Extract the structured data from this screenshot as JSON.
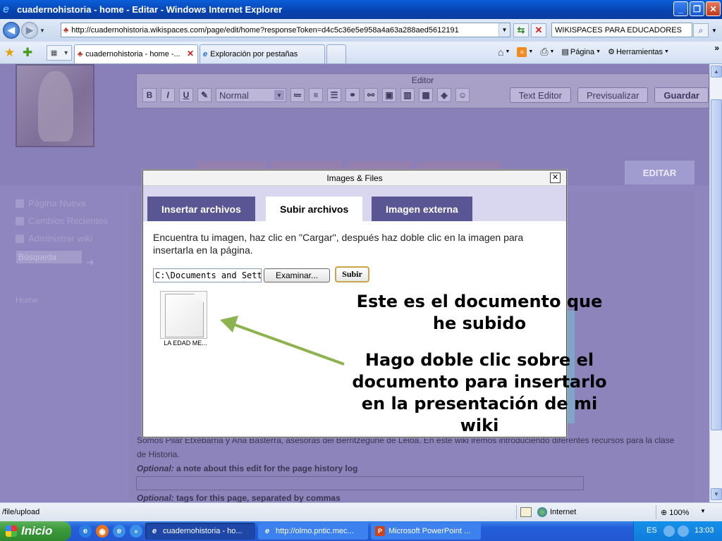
{
  "window": {
    "title": "cuadernohistoria - home - Editar - Windows Internet Explorer"
  },
  "address_bar": {
    "url": "http://cuadernohistoria.wikispaces.com/page/edit/home?responseToken=d4c5c36e5e958a4a63a288aed5612191",
    "search_value": "WIKISPACES PARA EDUCADORES"
  },
  "tabs": [
    {
      "label": "cuadernohistoria - home -..."
    },
    {
      "label": "Exploración por pestañas"
    }
  ],
  "command_bar": {
    "page": "Página",
    "tools": "Herramientas"
  },
  "editor": {
    "label": "Editor",
    "format": "Normal",
    "text_editor": "Text Editor",
    "preview": "Previsualizar",
    "save": "Guardar"
  },
  "wiki": {
    "editar_tab": "EDITAR",
    "sidebar": {
      "new_page": "Página Nueva",
      "recent_changes": "Cambios Recientes",
      "manage": "Administrar wiki",
      "search_placeholder": "Búsqueda",
      "home": "Home"
    },
    "intro": "Somos Pilar Etxebarria y Ana Basterra, asesoras del Berritzegune de Leioa. En este wiki iremos introduciendo diferentes recursos para la clase de Historia.",
    "optional_label": "Optional:",
    "optional_note": "a note about this edit for the page history log",
    "optional_tags": "tags for this page, separated by commas"
  },
  "dialog": {
    "title": "Images & Files",
    "tabs": {
      "insert": "Insertar archivos",
      "upload": "Subir archivos",
      "external": "Imagen externa"
    },
    "instructions": "Encuentra tu imagen, haz clic en \"Cargar\", después haz doble clic en la imagen para insertarla en la página.",
    "file_path": "C:\\Documents and Settings",
    "browse": "Examinar...",
    "upload": "Subir",
    "file_name": "LA EDAD ME..."
  },
  "annotations": {
    "uploaded_doc": "Este es el documento que he subido",
    "double_click": "Hago doble clic sobre el documento para insertarlo en la presentación de mi wiki"
  },
  "status_bar": {
    "text": "/file/upload",
    "zone": "Internet",
    "zoom": "100%"
  },
  "taskbar": {
    "start": "Inicio",
    "tasks": [
      "cuadernohistoria - ho...",
      "http://olmo.pntic.mec...",
      "Microsoft PowerPoint ..."
    ],
    "lang": "ES",
    "clock": "13:03"
  },
  "colors": {
    "overlay": "#8f85bf",
    "dialog_tab_dark": "#5a5693",
    "arrow": "#8db34f"
  }
}
